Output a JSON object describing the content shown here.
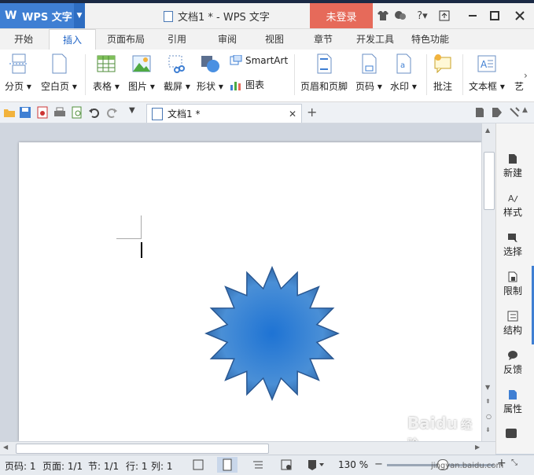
{
  "app": {
    "name": "WPS 文字",
    "window_title": "文档1 * - WPS 文字",
    "login_label": "未登录"
  },
  "tabs": [
    "开始",
    "插入",
    "页面布局",
    "引用",
    "审阅",
    "视图",
    "章节",
    "开发工具",
    "特色功能"
  ],
  "active_tab": "插入",
  "ribbon": {
    "page_break": "分页",
    "blank_page": "空白页",
    "table": "表格",
    "picture": "图片",
    "screenshot": "截屏",
    "shape": "形状",
    "smartart": "SmartArt",
    "chart": "图表",
    "header_footer": "页眉和页脚",
    "page_number": "页码",
    "watermark": "水印",
    "comment": "批注",
    "textbox": "文本框",
    "art": "艺"
  },
  "document_tab": {
    "title": "文档1 *"
  },
  "side_panel": [
    "新建",
    "样式",
    "选择",
    "限制",
    "结构",
    "反馈",
    "属性"
  ],
  "status": {
    "page_no": "页码: 1",
    "pages": "页面: 1/1",
    "section": "节: 1/1",
    "row": "行: 1",
    "col": "列: 1",
    "zoom": "130 %"
  },
  "watermark_text": {
    "logo": "Baidu",
    "sub": "经验",
    "url": "jingyan.baidu.com"
  },
  "colors": {
    "accent": "#3f7fd3",
    "login": "#e66a5a",
    "shape_fill": "#3b82d4",
    "shape_edge": "#27578f"
  }
}
